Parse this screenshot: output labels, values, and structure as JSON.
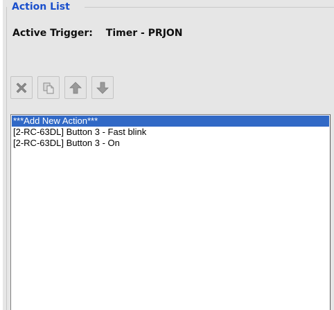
{
  "group": {
    "title": "Action List"
  },
  "trigger": {
    "label": "Active Trigger:",
    "value": "Timer - PRJON"
  },
  "toolbar": {
    "buttons": [
      {
        "name": "delete",
        "icon": "x-icon"
      },
      {
        "name": "copy",
        "icon": "copy-icon"
      },
      {
        "name": "move-up",
        "icon": "arrow-up-icon"
      },
      {
        "name": "move-down",
        "icon": "arrow-down-icon"
      }
    ]
  },
  "actions": {
    "items": [
      {
        "label": "***Add New Action***",
        "selected": true
      },
      {
        "label": "[2-RC-63DL] Button 3 - Fast blink",
        "selected": false
      },
      {
        "label": "[2-RC-63DL] Button 3 - On",
        "selected": false
      }
    ]
  },
  "colors": {
    "title": "#1a4fcc",
    "selection": "#3169c6",
    "panel": "#e6e6e6"
  }
}
